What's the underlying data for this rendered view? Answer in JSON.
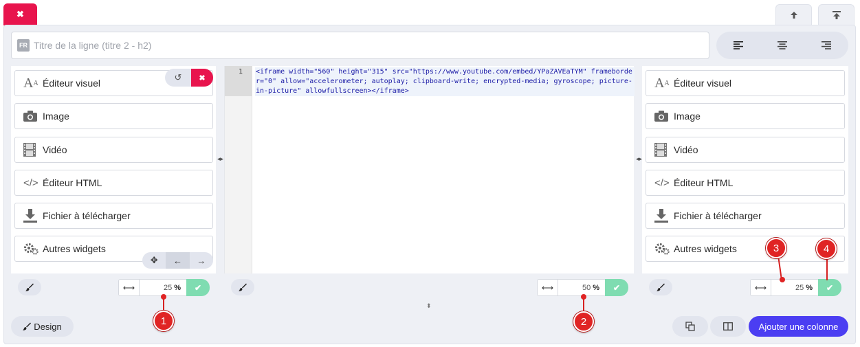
{
  "title_field": {
    "lang_badge": "FR",
    "placeholder": "Titre de la ligne (titre 2 - h2)"
  },
  "widgets": {
    "visual_editor": "Éditeur visuel",
    "image": "Image",
    "video": "Vidéo",
    "html_editor": "Éditeur HTML",
    "download": "Fichier à télécharger",
    "other": "Autres widgets"
  },
  "editor": {
    "line_number": "1",
    "code": "<iframe width=\"560\" height=\"315\" src=\"https://www.youtube.com/embed/YPaZAVEaTYM\" frameborder=\"0\" allow=\"accelerometer; autoplay; clipboard-write; encrypted-media; gyroscope; picture-in-picture\" allowfullscreen></iframe>"
  },
  "columns": {
    "left": {
      "width": "25",
      "unit": "%"
    },
    "middle": {
      "width": "50",
      "unit": "%"
    },
    "right": {
      "width": "25",
      "unit": "%"
    }
  },
  "footer": {
    "design_label": "Design",
    "add_column_label": "Ajouter une colonne"
  },
  "markers": [
    "1",
    "2",
    "3",
    "4"
  ],
  "colors": {
    "accent": "#4b3ef2",
    "danger": "#e8144d",
    "confirm": "#7fdcb1",
    "marker": "#e02424"
  }
}
